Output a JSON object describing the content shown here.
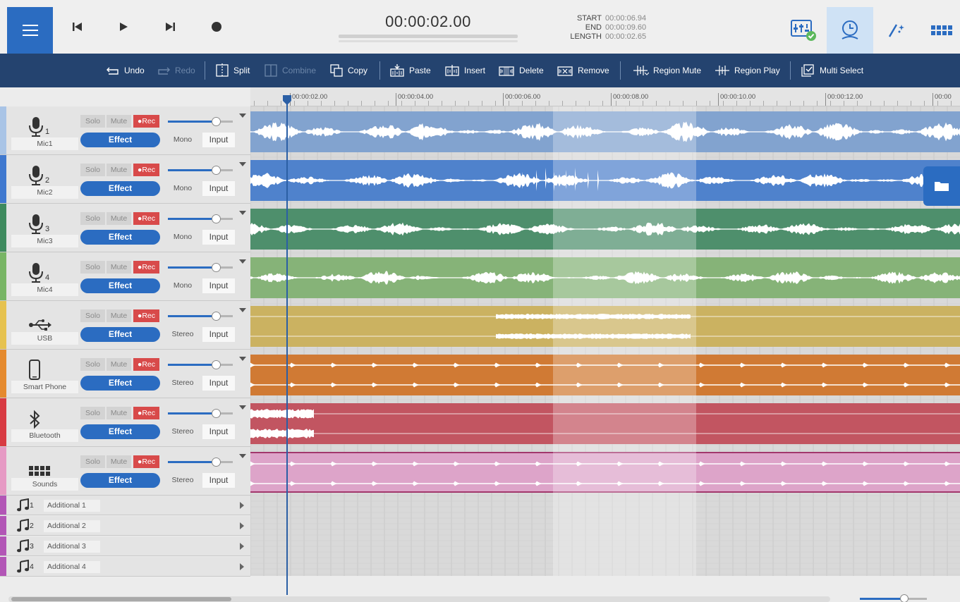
{
  "transport": {
    "timecode": "00:00:02.00",
    "start_label": "START",
    "start_value": "00:00:06.94",
    "end_label": "END",
    "end_value": "00:00:09.60",
    "length_label": "LENGTH",
    "length_value": "00:00:02.65"
  },
  "toolbar": {
    "undo": "Undo",
    "redo": "Redo",
    "split": "Split",
    "combine": "Combine",
    "copy": "Copy",
    "paste": "Paste",
    "insert": "Insert",
    "delete": "Delete",
    "remove": "Remove",
    "region_mute": "Region Mute",
    "region_play": "Region Play",
    "multi_select": "Multi Select"
  },
  "ruler": {
    "labels": [
      "00:00:02.00",
      "00:00:04.00",
      "00:00:06.00",
      "00:00:08.00",
      "00:00:10.00",
      "00:00:12.00",
      "00:00"
    ]
  },
  "tracks": [
    {
      "name": "Mic1",
      "number": "1",
      "icon": "microphone-icon",
      "mode": "Mono",
      "color": "#82a3cf",
      "strip": "#a9c4e6"
    },
    {
      "name": "Mic2",
      "number": "2",
      "icon": "microphone-icon",
      "mode": "Mono",
      "color": "#4f82cc",
      "strip": "#3f78cf"
    },
    {
      "name": "Mic3",
      "number": "3",
      "icon": "microphone-icon",
      "mode": "Mono",
      "color": "#4e8f6c",
      "strip": "#3e8a5e"
    },
    {
      "name": "Mic4",
      "number": "4",
      "icon": "microphone-icon",
      "mode": "Mono",
      "color": "#86b378",
      "strip": "#78b565"
    },
    {
      "name": "USB",
      "number": "",
      "icon": "usb-icon",
      "mode": "Stereo",
      "color": "#cbb261",
      "strip": "#e6c24f"
    },
    {
      "name": "Smart Phone",
      "number": "",
      "icon": "smartphone-icon",
      "mode": "Stereo",
      "color": "#d07a34",
      "strip": "#e58a2e"
    },
    {
      "name": "Bluetooth",
      "number": "",
      "icon": "bluetooth-icon",
      "mode": "Stereo",
      "color": "#c25561",
      "strip": "#d83a42"
    },
    {
      "name": "Sounds",
      "number": "",
      "icon": "sound-pads-icon",
      "mode": "Stereo",
      "color": "#dda4c9",
      "strip": "#e69ac4"
    }
  ],
  "track_controls": {
    "solo": "Solo",
    "mute": "Mute",
    "rec": "●Rec",
    "effect": "Effect",
    "input": "Input"
  },
  "additional_tracks": [
    {
      "number": "1",
      "name": "Additional 1"
    },
    {
      "number": "2",
      "name": "Additional 2"
    },
    {
      "number": "3",
      "name": "Additional 3"
    },
    {
      "number": "4",
      "name": "Additional 4"
    }
  ],
  "icons": {
    "menu": "hamburger-menu-icon",
    "prev": "skip-back-icon",
    "play": "play-icon",
    "next": "skip-forward-icon",
    "record": "record-icon",
    "mixer": "mixer-icon",
    "clock": "clock-icon",
    "wand": "magic-wand-icon",
    "pads": "grid-pads-icon",
    "folder": "folder-icon"
  }
}
